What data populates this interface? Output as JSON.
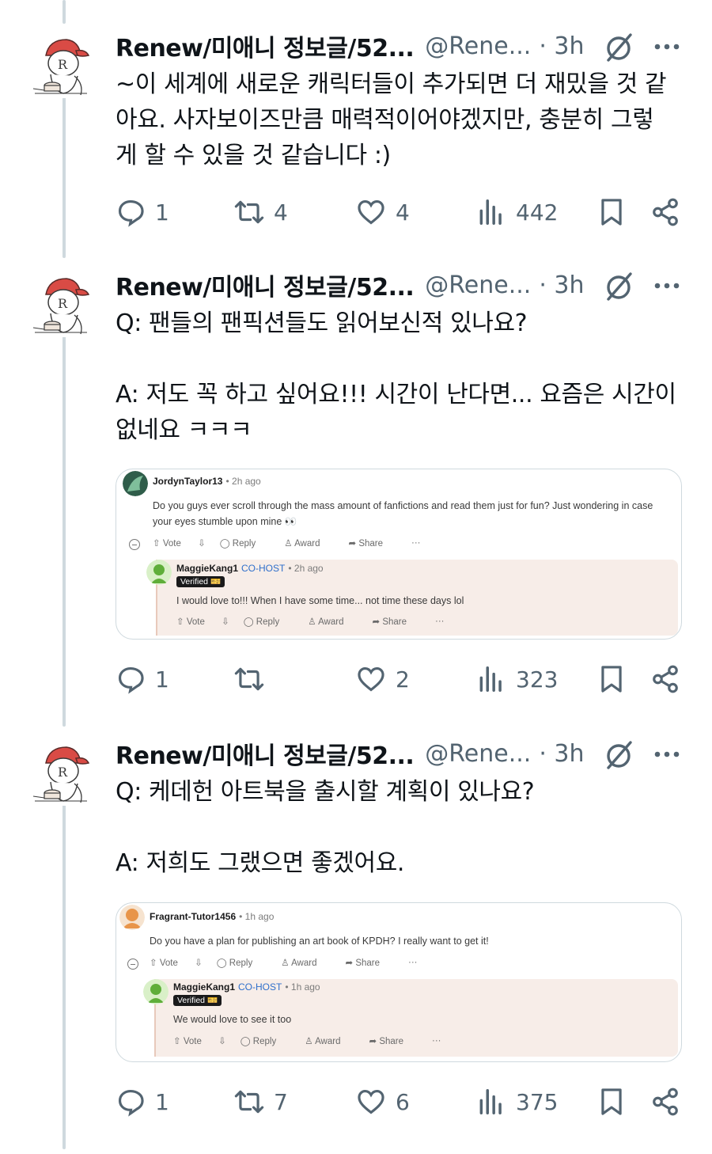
{
  "tweets": [
    {
      "name": "Renew/미애니 정보글/52...",
      "handle": "@Rene...",
      "time": "· 3h",
      "lines": [
        "~이 세계에 새로운 캐릭터들이 추가되면 더 재밌을 것 같",
        "아요. 사자보이즈만큼 매력적이어야겠지만, 충분히 그렇",
        "게 할 수 있을 것 같습니다 :)"
      ],
      "replies": "1",
      "reposts": "4",
      "likes": "4",
      "views": "442"
    },
    {
      "name": "Renew/미애니 정보글/52...",
      "handle": "@Rene...",
      "time": "· 3h",
      "question": "Q: 팬들의 팬픽션들도 읽어보신적 있나요?",
      "answer_lines": [
        "A: 저도 꼭 하고 싶어요!!! 시간이 난다면... 요즘은 시간이",
        "없네요 ㅋㅋㅋ"
      ],
      "card": {
        "commenter": "JordynTaylor13",
        "commenter_time": "• 2h ago",
        "comment": "Do you guys ever scroll through the mass amount of fanfictions and read them just for fun? Just wondering in case your eyes stumble upon mine 👀",
        "reply_user": "MaggieKang1",
        "reply_role": "CO-HOST",
        "reply_time": "• 2h ago",
        "verified": "Verified 🎫",
        "reply_text": "I would love to!!! When I have some time... not time these days lol"
      },
      "replies": "1",
      "reposts": "",
      "likes": "2",
      "views": "323"
    },
    {
      "name": "Renew/미애니 정보글/52...",
      "handle": "@Rene...",
      "time": "· 3h",
      "question": "Q: 케데헌 아트북을 출시할 계획이 있나요?",
      "answer_lines": [
        "A: 저희도 그랬으면 좋겠어요."
      ],
      "card": {
        "commenter": "Fragrant-Tutor1456",
        "commenter_time": "• 1h ago",
        "comment": "Do you have a plan for publishing an art book of KPDH? I really want to get it!",
        "reply_user": "MaggieKang1",
        "reply_role": "CO-HOST",
        "reply_time": "• 1h ago",
        "verified": "Verified 🎫",
        "reply_text": "We would love to see it too"
      },
      "replies": "1",
      "reposts": "7",
      "likes": "6",
      "views": "375"
    }
  ],
  "card_actions": {
    "vote": "Vote",
    "reply": "Reply",
    "award": "Award",
    "share": "Share",
    "more": "···"
  },
  "colors": {
    "text": "#0f1419",
    "muted": "#536471",
    "thread_line": "#cfd9de",
    "cohost_blue": "#2f6fcb",
    "reply_bg": "#f7ede8"
  },
  "icons": [
    "reply-icon",
    "repost-icon",
    "like-icon",
    "views-icon",
    "bookmark-icon",
    "share-icon",
    "grok-icon",
    "more-icon"
  ]
}
